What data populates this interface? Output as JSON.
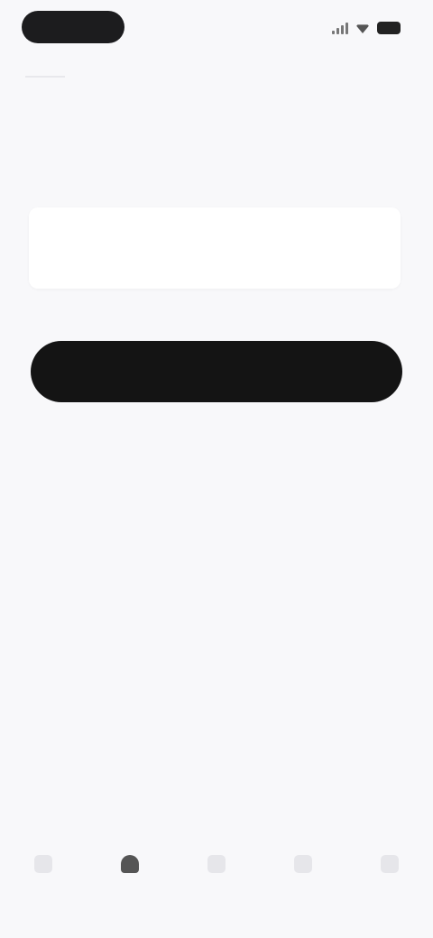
{
  "status_bar": {
    "time": ""
  },
  "screen": {
    "title": "",
    "subtitle": ""
  },
  "input": {
    "value": "",
    "placeholder": ""
  },
  "primary_button": {
    "label": ""
  },
  "bottom_nav": {
    "active_index": 1,
    "items": [
      {
        "icon": "home-icon",
        "label": ""
      },
      {
        "icon": "document-icon",
        "label": ""
      },
      {
        "icon": "add-icon",
        "label": ""
      },
      {
        "icon": "chat-icon",
        "label": ""
      },
      {
        "icon": "profile-icon",
        "label": ""
      }
    ]
  },
  "colors": {
    "background": "#f8f8fa",
    "button": "#141414",
    "card": "#ffffff"
  }
}
